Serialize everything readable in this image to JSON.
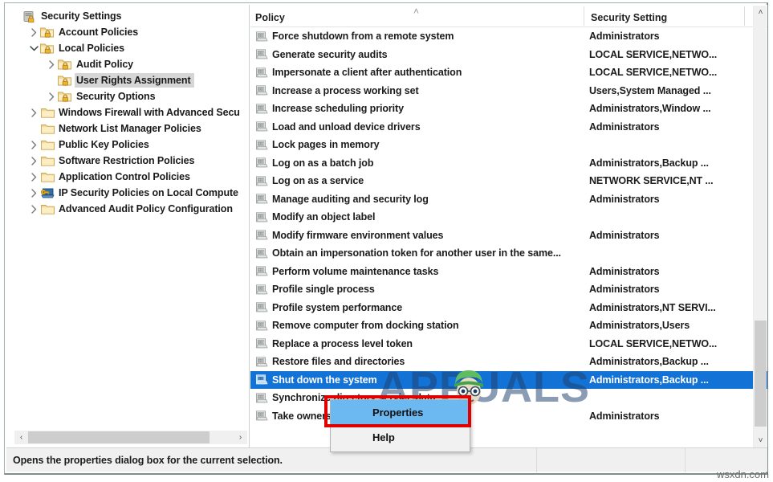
{
  "tree": {
    "items": [
      {
        "label": "Security Settings",
        "indent": 0,
        "twisty": "none",
        "icon": "security-settings-icon",
        "selected": false
      },
      {
        "label": "Account Policies",
        "indent": 1,
        "twisty": "collapsed",
        "icon": "folder-lock-icon",
        "selected": false
      },
      {
        "label": "Local Policies",
        "indent": 1,
        "twisty": "expanded",
        "icon": "folder-lock-icon",
        "selected": false
      },
      {
        "label": "Audit Policy",
        "indent": 2,
        "twisty": "collapsed",
        "icon": "folder-lock-icon",
        "selected": false
      },
      {
        "label": "User Rights Assignment",
        "indent": 2,
        "twisty": "none",
        "icon": "folder-lock-icon",
        "selected": true
      },
      {
        "label": "Security Options",
        "indent": 2,
        "twisty": "collapsed",
        "icon": "folder-lock-icon",
        "selected": false
      },
      {
        "label": "Windows Firewall with Advanced Secu",
        "indent": 1,
        "twisty": "collapsed",
        "icon": "folder-icon",
        "selected": false
      },
      {
        "label": "Network List Manager Policies",
        "indent": 1,
        "twisty": "none",
        "icon": "folder-icon",
        "selected": false
      },
      {
        "label": "Public Key Policies",
        "indent": 1,
        "twisty": "collapsed",
        "icon": "folder-icon",
        "selected": false
      },
      {
        "label": "Software Restriction Policies",
        "indent": 1,
        "twisty": "collapsed",
        "icon": "folder-icon",
        "selected": false
      },
      {
        "label": "Application Control Policies",
        "indent": 1,
        "twisty": "collapsed",
        "icon": "folder-icon",
        "selected": false
      },
      {
        "label": "IP Security Policies on Local Compute",
        "indent": 1,
        "twisty": "collapsed",
        "icon": "ip-security-icon",
        "selected": false
      },
      {
        "label": "Advanced Audit Policy Configuration",
        "indent": 1,
        "twisty": "collapsed",
        "icon": "folder-icon",
        "selected": false
      }
    ]
  },
  "list": {
    "columns": {
      "policy": "Policy",
      "setting": "Security Setting",
      "sort_indicator": "ascending"
    },
    "rows": [
      {
        "policy": "Force shutdown from a remote system",
        "setting": "Administrators",
        "selected": false
      },
      {
        "policy": "Generate security audits",
        "setting": "LOCAL SERVICE,NETWO...",
        "selected": false
      },
      {
        "policy": "Impersonate a client after authentication",
        "setting": "LOCAL SERVICE,NETWO...",
        "selected": false
      },
      {
        "policy": "Increase a process working set",
        "setting": "Users,System Managed ...",
        "selected": false
      },
      {
        "policy": "Increase scheduling priority",
        "setting": "Administrators,Window ...",
        "selected": false
      },
      {
        "policy": "Load and unload device drivers",
        "setting": "Administrators",
        "selected": false
      },
      {
        "policy": "Lock pages in memory",
        "setting": "",
        "selected": false
      },
      {
        "policy": "Log on as a batch job",
        "setting": "Administrators,Backup ...",
        "selected": false
      },
      {
        "policy": "Log on as a service",
        "setting": "NETWORK SERVICE,NT ...",
        "selected": false
      },
      {
        "policy": "Manage auditing and security log",
        "setting": "Administrators",
        "selected": false
      },
      {
        "policy": "Modify an object label",
        "setting": "",
        "selected": false
      },
      {
        "policy": "Modify firmware environment values",
        "setting": "Administrators",
        "selected": false
      },
      {
        "policy": "Obtain an impersonation token for another user in the same...",
        "setting": "",
        "selected": false
      },
      {
        "policy": "Perform volume maintenance tasks",
        "setting": "Administrators",
        "selected": false
      },
      {
        "policy": "Profile single process",
        "setting": "Administrators",
        "selected": false
      },
      {
        "policy": "Profile system performance",
        "setting": "Administrators,NT SERVI...",
        "selected": false
      },
      {
        "policy": "Remove computer from docking station",
        "setting": "Administrators,Users",
        "selected": false
      },
      {
        "policy": "Replace a process level token",
        "setting": "LOCAL SERVICE,NETWO...",
        "selected": false
      },
      {
        "policy": "Restore files and directories",
        "setting": "Administrators,Backup ...",
        "selected": false
      },
      {
        "policy": "Shut down the system",
        "setting": "Administrators,Backup ...",
        "selected": true
      },
      {
        "policy": "Synchronize directory service data",
        "setting": "",
        "selected": false
      },
      {
        "policy": "Take ownership of files or other objects",
        "setting": "Administrators",
        "selected": false
      }
    ]
  },
  "context_menu": {
    "items": [
      {
        "label": "Properties",
        "highlighted": true
      },
      {
        "label": "Help",
        "highlighted": false
      }
    ]
  },
  "status_bar": {
    "message": "Opens the properties dialog box for the current selection.",
    "segment2": "",
    "segment3": ""
  },
  "watermarks": {
    "brand": "APPUALS",
    "site": "wsxdn.com"
  },
  "colors": {
    "selection_blue": "#1372d6",
    "menu_highlight": "#6cb8f0",
    "red_box": "#e00000",
    "tree_selection": "#d6d6d6"
  },
  "icons": {
    "scroll_up": "˄",
    "scroll_down": "˅",
    "scroll_left": "‹",
    "scroll_right": "›",
    "sort_ascending": "˄"
  }
}
